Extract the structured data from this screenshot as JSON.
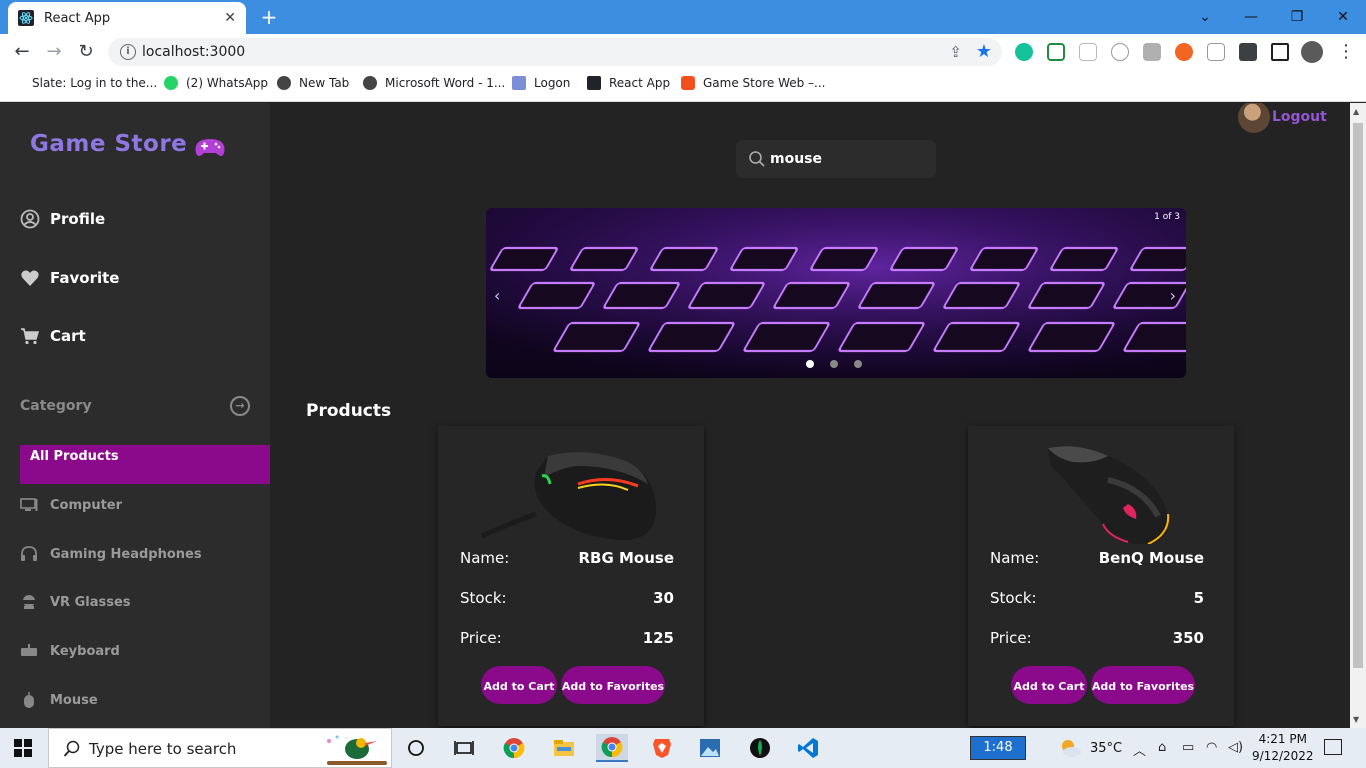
{
  "browser": {
    "tab_title": "React App",
    "tab_close": "✕",
    "new_tab": "+",
    "url": "localhost:3000",
    "window_controls": [
      "⌄",
      "—",
      "❐",
      "✕"
    ]
  },
  "bookmarks": [
    {
      "label": "Slate: Log in to the...",
      "color": "#1565c0"
    },
    {
      "label": "(2) WhatsApp",
      "color": "#25d366"
    },
    {
      "label": "New Tab",
      "color": "#444444"
    },
    {
      "label": "Microsoft Word - 1...",
      "color": "#444444"
    },
    {
      "label": "Logon",
      "color": "#7b8ed6"
    },
    {
      "label": "React App",
      "color": "#20232a"
    },
    {
      "label": "Game Store Web –...",
      "color": "#f24e1e"
    }
  ],
  "header": {
    "logout_label": "Logout"
  },
  "sidebar": {
    "brand": "Game Store",
    "main_items": [
      {
        "label": "Profile",
        "icon": "user-circle-icon"
      },
      {
        "label": "Favorite",
        "icon": "heart-icon"
      },
      {
        "label": "Cart",
        "icon": "cart-icon"
      }
    ],
    "category_label": "Category",
    "category_arrow": "→",
    "active_category": "All Products",
    "categories": [
      {
        "label": "Computer",
        "icon": "monitor-icon"
      },
      {
        "label": "Gaming Headphones",
        "icon": "headphones-icon"
      },
      {
        "label": "VR Glasses",
        "icon": "vr-glasses-icon"
      },
      {
        "label": "Keyboard",
        "icon": "keyboard-icon"
      },
      {
        "label": "Mouse",
        "icon": "mouse-icon"
      }
    ]
  },
  "search": {
    "value": "mouse"
  },
  "carousel": {
    "counter": "1 of 3",
    "prev": "‹",
    "next": "›",
    "active_index": 0,
    "slide_count": 3
  },
  "products": {
    "title": "Products",
    "name_label": "Name:",
    "stock_label": "Stock:",
    "price_label": "Price:",
    "add_cart_label": "Add to Cart",
    "add_fav_label": "Add to Favorites",
    "items": [
      {
        "name": "RBG Mouse",
        "stock": "30",
        "price": "125"
      },
      {
        "name": "BenQ Mouse",
        "stock": "5",
        "price": "350"
      }
    ]
  },
  "taskbar": {
    "search_placeholder": "Type here to search",
    "timer": "1:48",
    "temperature": "35°C",
    "time": "4:21 PM",
    "date": "9/12/2022"
  },
  "colors": {
    "accent": "#8b0a8b",
    "brand": "#8e77e3",
    "logout": "#9455d6"
  }
}
